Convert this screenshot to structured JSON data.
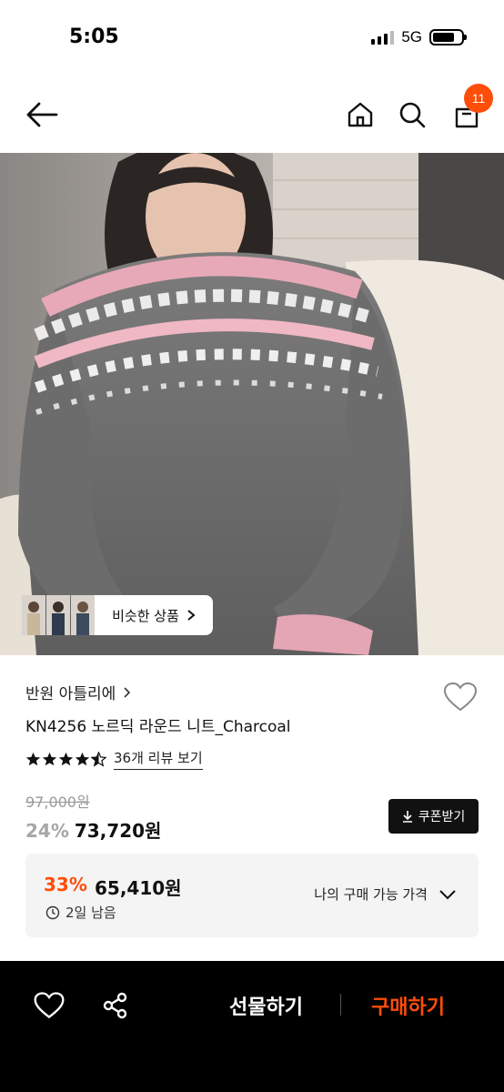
{
  "status_bar": {
    "time": "5:05",
    "network": "5G"
  },
  "nav": {
    "back_icon": "arrow-left-icon",
    "home_icon": "home-icon",
    "search_icon": "search-icon",
    "cart_icon": "shopping-bag-icon",
    "cart_count": "11"
  },
  "hero": {
    "similar_label": "비슷한 상품"
  },
  "product": {
    "brand": "반원 아틀리에",
    "name": "KN4256 노르딕 라운드 니트_Charcoal",
    "rating": 4.5,
    "review_link": "36개 리뷰 보기",
    "original_price": "97,000원",
    "discount_rate": "24%",
    "sale_price": "73,720원",
    "coupon_label": "쿠폰받기"
  },
  "my_price": {
    "discount_rate": "33%",
    "price": "65,410원",
    "time_left": "2일 남음",
    "label": "나의 구매 가능 가격"
  },
  "bottom_bar": {
    "gift_label": "선물하기",
    "buy_label": "구매하기"
  },
  "colors": {
    "accent": "#ff4d0a",
    "dark": "#000000",
    "muted": "#a7a7a7"
  }
}
